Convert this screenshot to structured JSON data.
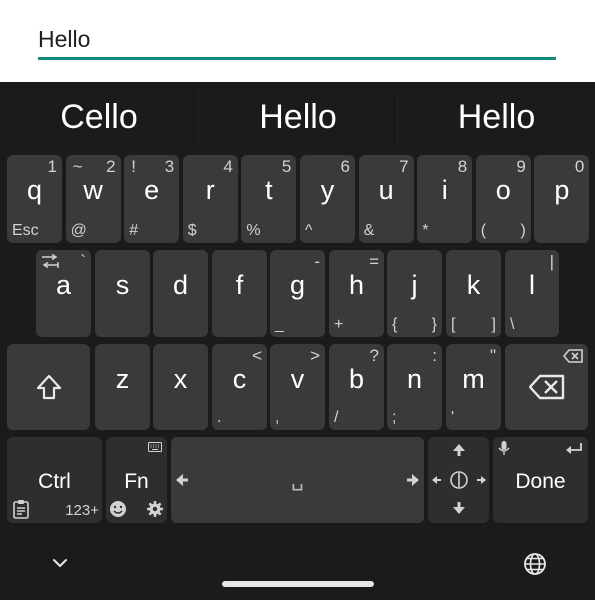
{
  "input": {
    "value": "Hello"
  },
  "suggestions": [
    "Cello",
    "Hello",
    "Hello"
  ],
  "rows": {
    "row1": [
      {
        "main": "q",
        "tr": "1",
        "bl": "Esc"
      },
      {
        "main": "w",
        "tl": "~",
        "tr": "2",
        "bl": "@"
      },
      {
        "main": "e",
        "tl": "!",
        "tr": "3",
        "bl": "#"
      },
      {
        "main": "r",
        "tr": "4",
        "bl": "$"
      },
      {
        "main": "t",
        "tr": "5",
        "bl": "%"
      },
      {
        "main": "y",
        "tr": "6",
        "bl": "^"
      },
      {
        "main": "u",
        "tr": "7",
        "bl": "&"
      },
      {
        "main": "i",
        "tr": "8",
        "bl": "*"
      },
      {
        "main": "o",
        "tr": "9",
        "bl": "(",
        "br": ")"
      },
      {
        "main": "p",
        "tr": "0"
      }
    ],
    "row2": [
      {
        "main": "a",
        "tr": "`"
      },
      {
        "main": "s"
      },
      {
        "main": "d"
      },
      {
        "main": "f"
      },
      {
        "main": "g",
        "tr": "-",
        "bl": "_"
      },
      {
        "main": "h",
        "tr": "=",
        "bl": "+"
      },
      {
        "main": "j",
        "bl": "{",
        "br": "}"
      },
      {
        "main": "k",
        "bl": "[",
        "br": "]"
      },
      {
        "main": "l",
        "tr": "|",
        "bl": "\\"
      }
    ],
    "row3": [
      {
        "main": "z"
      },
      {
        "main": "x"
      },
      {
        "main": "c",
        "tr": "<",
        "bl": "."
      },
      {
        "main": "v",
        "tr": ">",
        "bl": ","
      },
      {
        "main": "b",
        "tr": "?",
        "bl": "/"
      },
      {
        "main": "n",
        "tr": ":",
        "bl": ";"
      },
      {
        "main": "m",
        "tr": "\"",
        "bl": "'"
      }
    ]
  },
  "bottom": {
    "ctrl": "Ctrl",
    "fn": "Fn",
    "num": "123+",
    "space_glyph": "␣",
    "done": "Done"
  },
  "colors": {
    "accent": "#138a7c",
    "key": "#3a3a3a",
    "key_dark": "#2e2e2e",
    "background": "#1b1b1b"
  },
  "icons": [
    "tab-icon",
    "shift-icon",
    "backspace-icon",
    "clipboard-icon",
    "keyboard-icon",
    "emoji-icon",
    "settings-icon",
    "arrow-left-icon",
    "arrow-right-icon",
    "arrow-up-icon",
    "arrow-down-icon",
    "cursor-pad-icon",
    "mic-icon",
    "enter-icon",
    "hide-keyboard-icon",
    "globe-icon"
  ]
}
